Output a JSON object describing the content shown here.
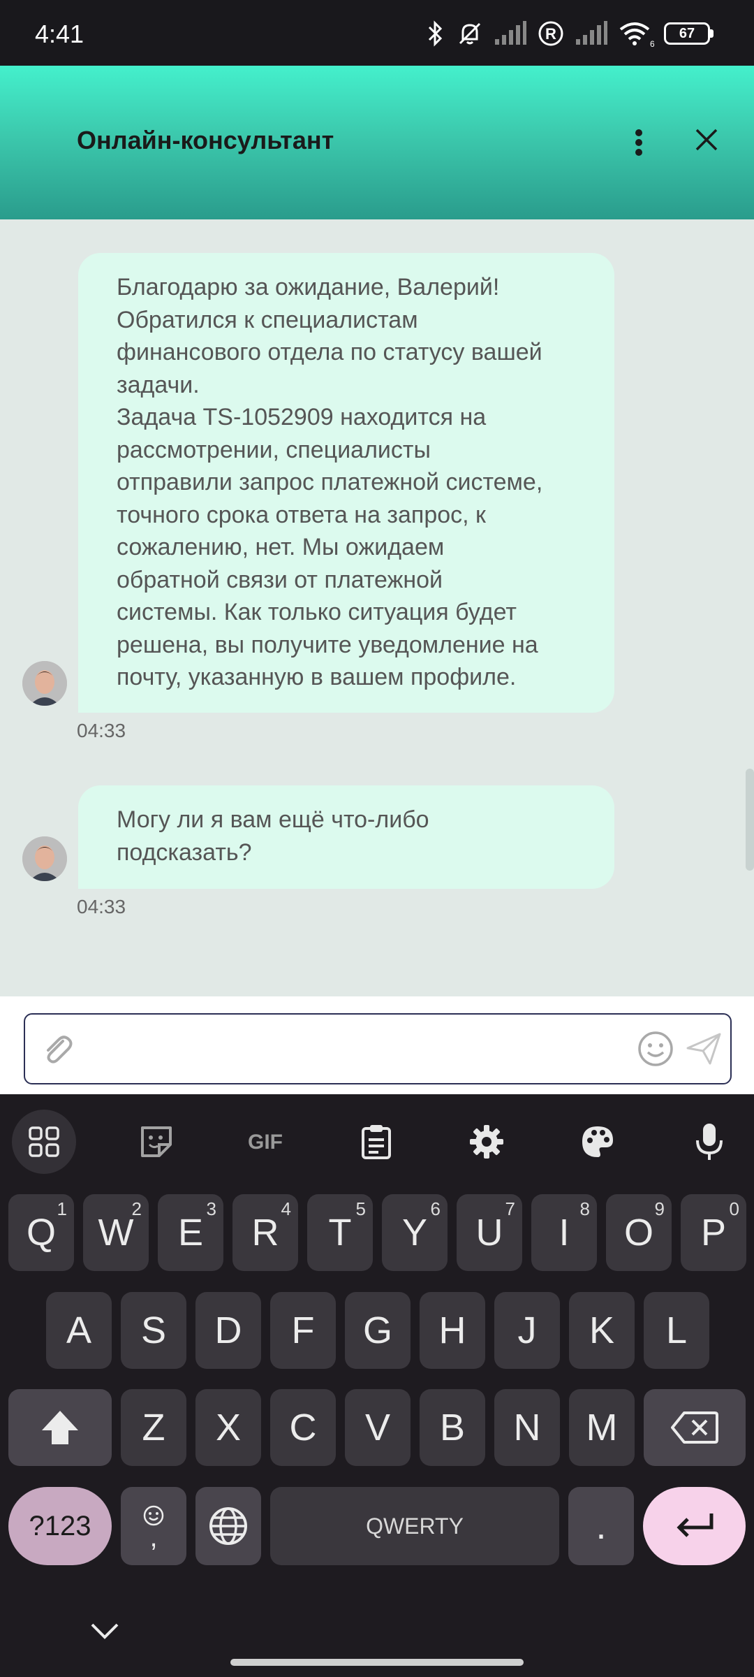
{
  "status_bar": {
    "time": "4:41",
    "battery": "67",
    "network_badge": "6"
  },
  "header": {
    "title": "Онлайн-консультант"
  },
  "messages": [
    {
      "text": "Благодарю за ожидание, Валерий!\nОбратился к специалистам\nфинансового отдела по статусу вашей\nзадачи.\nЗадача TS-1052909 находится на\nрассмотрении, специалисты\nотправили запрос платежной системе,\nточного срока ответа на запрос, к\nсожалению, нет. Мы ожидаем\nобратной связи от платежной\nсистемы. Как только ситуация будет\nрешена, вы получите уведомление на\nпочту, указанную в вашем профиле.",
      "time": "04:33"
    },
    {
      "text": "Могу ли я вам ещё что-либо\nподсказать?",
      "time": "04:33"
    }
  ],
  "input": {
    "value": "",
    "placeholder": ""
  },
  "keyboard": {
    "toolbar": [
      "apps-icon",
      "sticker-icon",
      "GIF",
      "clipboard-icon",
      "settings-icon",
      "palette-icon",
      "mic-icon"
    ],
    "row1": [
      {
        "k": "Q",
        "h": "1"
      },
      {
        "k": "W",
        "h": "2"
      },
      {
        "k": "E",
        "h": "3"
      },
      {
        "k": "R",
        "h": "4"
      },
      {
        "k": "T",
        "h": "5"
      },
      {
        "k": "Y",
        "h": "6"
      },
      {
        "k": "U",
        "h": "7"
      },
      {
        "k": "I",
        "h": "8"
      },
      {
        "k": "O",
        "h": "9"
      },
      {
        "k": "P",
        "h": "0"
      }
    ],
    "row2": [
      "A",
      "S",
      "D",
      "F",
      "G",
      "H",
      "J",
      "K",
      "L"
    ],
    "row3": [
      "Z",
      "X",
      "C",
      "V",
      "B",
      "N",
      "M"
    ],
    "symbols_label": "?123",
    "comma_label": ",",
    "space_label": "QWERTY",
    "period_label": "."
  },
  "colors": {
    "header_top": "#44f0cc",
    "bubble": "#dcfaee",
    "chat_bg": "#e1e9e6",
    "enter_key": "#f7d2ea",
    "symbols_key": "#c8a9c1"
  }
}
